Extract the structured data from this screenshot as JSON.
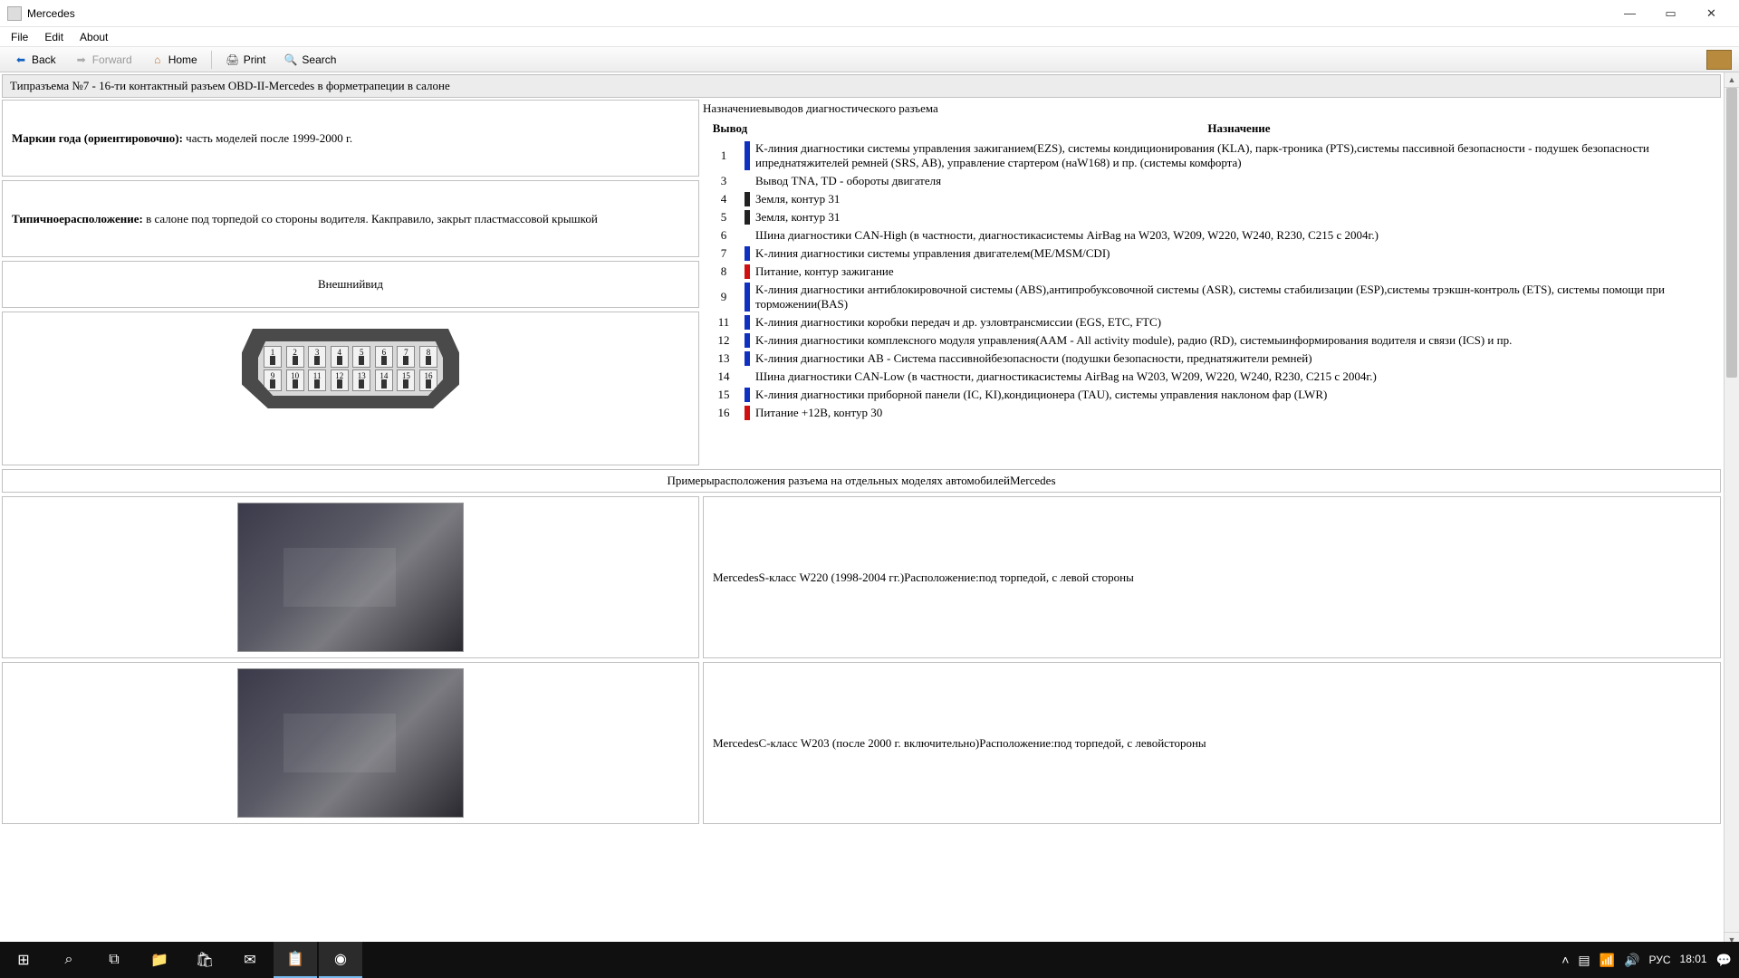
{
  "window": {
    "title": "Mercedes"
  },
  "menu": {
    "file": "File",
    "edit": "Edit",
    "about": "About"
  },
  "toolbar": {
    "back": "Back",
    "forward": "Forward",
    "home": "Home",
    "print": "Print",
    "search": "Search"
  },
  "page": {
    "section_title": "Типразъема №7 - 16-ти контактный разъем OBD-II-Mercedes в форметрапеции в салоне",
    "model_years_label": "Маркии года (ориентировочно):",
    "model_years_value": " часть моделей после 1999-2000 г.",
    "location_label": "Типичноерасположение:",
    "location_value": " в салоне под торпедой со стороны водителя. Какправило, закрыт пластмассовой крышкой",
    "appearance_label": "Внешнийвид",
    "pinout_title": "Назначениевыводов диагностического разъема",
    "col_pin": "Вывод",
    "col_desc": "Назначение",
    "pins": [
      {
        "n": "1",
        "color": "#1030c0",
        "desc": "K-линия диагностики системы управления зажиганием(EZS), системы кондиционирования (KLA), парк-троника (PTS),системы пассивной безопасности - подушек безопасности ипреднатяжителей ремней (SRS, AB), управление стартером (наW168) и пр. (системы комфорта)"
      },
      {
        "n": "3",
        "color": "",
        "desc": "Вывод TNA, TD - обороты двигателя"
      },
      {
        "n": "4",
        "color": "#222",
        "desc": "Земля, контур 31"
      },
      {
        "n": "5",
        "color": "#222",
        "desc": "Земля, контур 31"
      },
      {
        "n": "6",
        "color": "",
        "desc": "Шина диагностики CAN-High (в частности, диагностикасистемы AirBag на W203, W209, W220, W240, R230, C215 с 2004г.)"
      },
      {
        "n": "7",
        "color": "#1030c0",
        "desc": "K-линия диагностики системы управления двигателем(ME/MSM/CDI)"
      },
      {
        "n": "8",
        "color": "#d01010",
        "desc": "Питание, контур зажигание"
      },
      {
        "n": "9",
        "color": "#1030c0",
        "desc": "K-линия диагностики антиблокировочной системы (ABS),антипробуксовочной системы (ASR), системы стабилизации (ESP),системы трэкшн-контроль (ETS), системы помощи при торможении(BAS)"
      },
      {
        "n": "11",
        "color": "#1030c0",
        "desc": "K-линия диагностики коробки передач и др. узловтрансмиссии (EGS, ETC, FTC)"
      },
      {
        "n": "12",
        "color": "#1030c0",
        "desc": "K-линия диагностики комплексного модуля управления(AAM - All activity module), радио (RD), системыинформирования водителя и связи (ICS) и пр."
      },
      {
        "n": "13",
        "color": "#1030c0",
        "desc": "K-линия диагностики AB - Система пассивнойбезопасности (подушки безопасности, преднатяжители ремней)"
      },
      {
        "n": "14",
        "color": "",
        "desc": "Шина диагностики CAN-Low (в частности, диагностикасистемы AirBag на W203, W209, W220, W240, R230, C215 с 2004г.)"
      },
      {
        "n": "15",
        "color": "#1030c0",
        "desc": "K-линия диагностики приборной панели (IC, KI),кондиционера (TAU), системы управления наклоном фар (LWR)"
      },
      {
        "n": "16",
        "color": "#d01010",
        "desc": "Питание +12B, контур 30"
      }
    ],
    "examples_header": "Примерырасположения разъема на отдельных моделях автомобилейMercedes",
    "examples": [
      {
        "caption": "MercedesS-класс W220 (1998-2004 гг.)Расположение:под торпедой, с левой стороны"
      },
      {
        "caption": "MercedesC-класс W203 (после 2000 г. включительно)Расположение:под торпедой, с левойстороны"
      }
    ]
  },
  "taskbar": {
    "lang": "РУС",
    "time": "18:01"
  }
}
